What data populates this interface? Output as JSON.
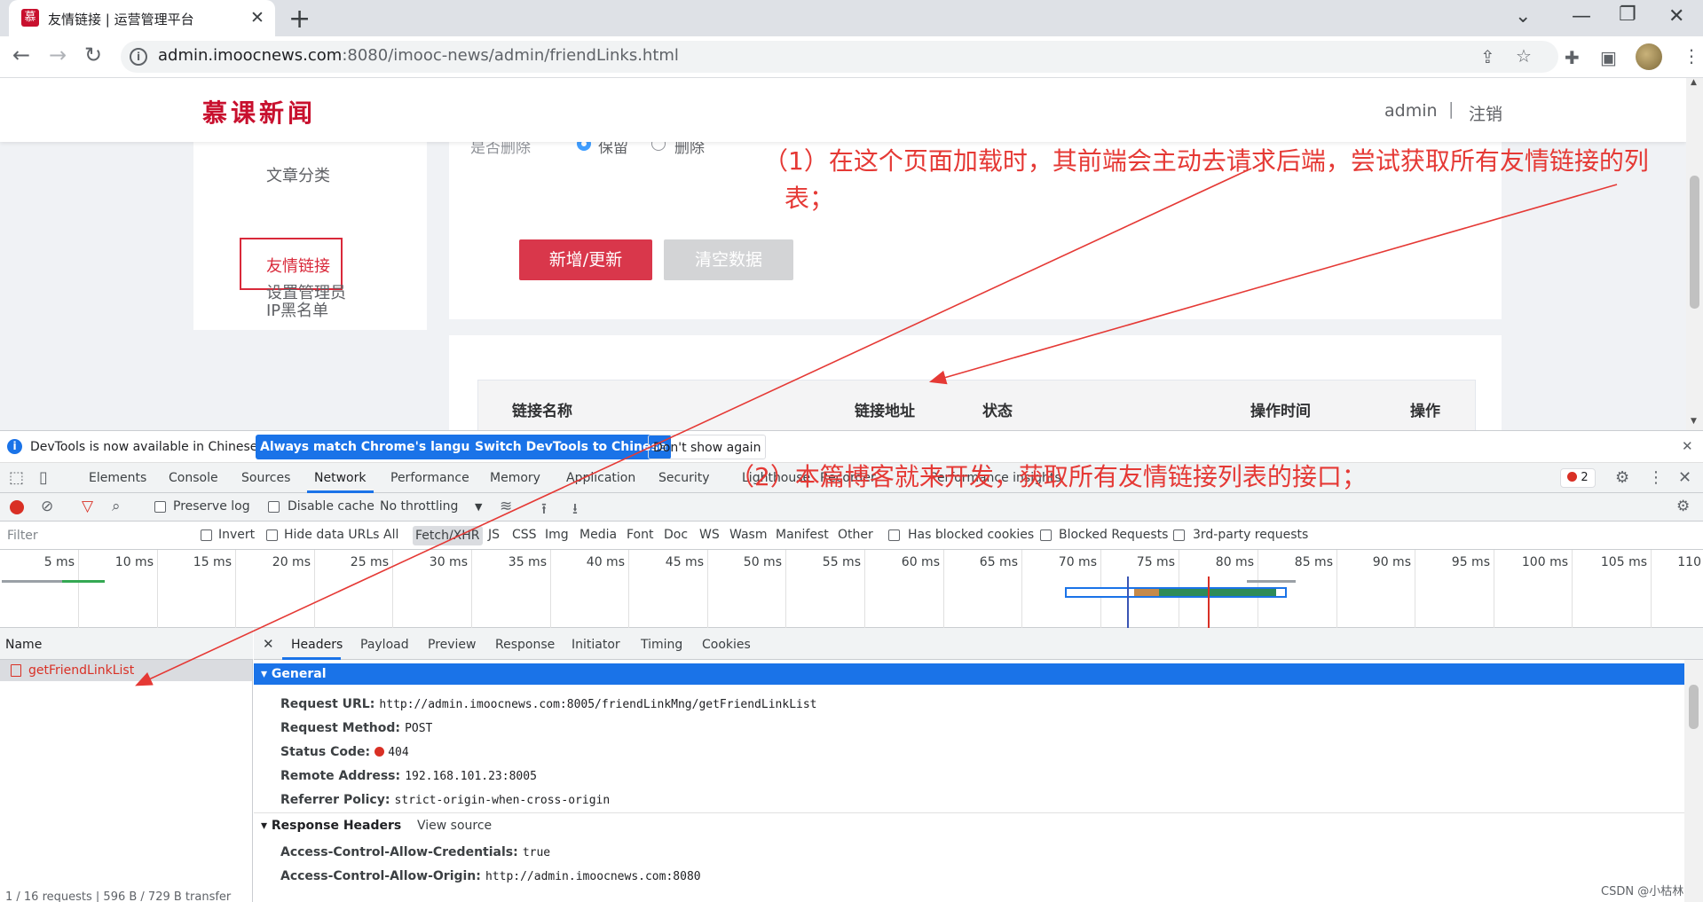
{
  "browser": {
    "tab_title": "友情链接 | 运营管理平台",
    "tab_favicon": "慕",
    "url_host": "admin.imoocnews.com",
    "url_rest": ":8080/imooc-news/admin/friendLinks.html"
  },
  "site": {
    "logo": "慕课新闻",
    "user": "admin",
    "separator": "|",
    "logout": "注销"
  },
  "sidenav": {
    "items": [
      {
        "label": "文章分类"
      },
      {
        "label": "友情链接"
      },
      {
        "label": "IP黑名单"
      },
      {
        "label": "设置管理员"
      }
    ],
    "active_index": 1
  },
  "form": {
    "delete_label": "是否删除",
    "radio_keep": "保留",
    "radio_delete": "删除",
    "save_button": "新增/更新",
    "clear_button": "清空数据"
  },
  "table": {
    "columns": [
      "链接名称",
      "链接地址",
      "状态",
      "操作时间",
      "操作"
    ]
  },
  "devtools": {
    "infobar_text": "DevTools is now available in Chinese!",
    "infobar_btn1": "Always match Chrome's language",
    "infobar_btn2": "Switch DevTools to Chinese",
    "infobar_btn3": "Don't show again",
    "tabs": [
      "Elements",
      "Console",
      "Sources",
      "Network",
      "Performance",
      "Memory",
      "Application",
      "Security",
      "Lighthouse",
      "Recorder",
      "Performance insights"
    ],
    "error_count": "2",
    "toolbar": {
      "preserve_log": "Preserve log",
      "disable_cache": "Disable cache",
      "throttling": "No throttling"
    },
    "filter": {
      "placeholder": "Filter",
      "invert": "Invert",
      "hide_data_urls": "Hide data URLs",
      "types": [
        "All",
        "Fetch/XHR",
        "JS",
        "CSS",
        "Img",
        "Media",
        "Font",
        "Doc",
        "WS",
        "Wasm",
        "Manifest",
        "Other"
      ],
      "blocked_cookies": "Has blocked cookies",
      "blocked_requests": "Blocked Requests",
      "third_party": "3rd-party requests"
    },
    "timeline_ticks": [
      "5 ms",
      "10 ms",
      "15 ms",
      "20 ms",
      "25 ms",
      "30 ms",
      "35 ms",
      "40 ms",
      "45 ms",
      "50 ms",
      "55 ms",
      "60 ms",
      "65 ms",
      "70 ms",
      "75 ms",
      "80 ms",
      "85 ms",
      "90 ms",
      "95 ms",
      "100 ms",
      "105 ms",
      "110"
    ],
    "name_header": "Name",
    "request_name": "getFriendLinkList",
    "summary": "1 / 16 requests  |  596 B / 729 B transfer",
    "detail_tabs": [
      "Headers",
      "Payload",
      "Preview",
      "Response",
      "Initiator",
      "Timing",
      "Cookies"
    ],
    "general_title": "▾ General",
    "general": [
      {
        "key": "Request URL:",
        "value": "http://admin.imoocnews.com:8005/friendLinkMng/getFriendLinkList"
      },
      {
        "key": "Request Method:",
        "value": "POST"
      },
      {
        "key": "Status Code:",
        "value": "404"
      },
      {
        "key": "Remote Address:",
        "value": "192.168.101.23:8005"
      },
      {
        "key": "Referrer Policy:",
        "value": "strict-origin-when-cross-origin"
      }
    ],
    "response_headers_title": "▾ Response Headers",
    "view_source": "View source",
    "response_headers": [
      {
        "key": "Access-Control-Allow-Credentials:",
        "value": "true"
      },
      {
        "key": "Access-Control-Allow-Origin:",
        "value": "http://admin.imoocnews.com:8080"
      }
    ]
  },
  "annotations": {
    "note1_line1": "（1）在这个页面加载时，其前端会主动去请求后端，尝试获取所有友情链接的列",
    "note1_line2": "表；",
    "note2": "（2）本篇博客就来开发，获取所有友情链接列表的接口；",
    "watermark": "CSDN @小枯林"
  },
  "colors": {
    "accent_red": "#d9374b",
    "annotation_red": "#e53935",
    "devtools_blue": "#1a73e8"
  }
}
